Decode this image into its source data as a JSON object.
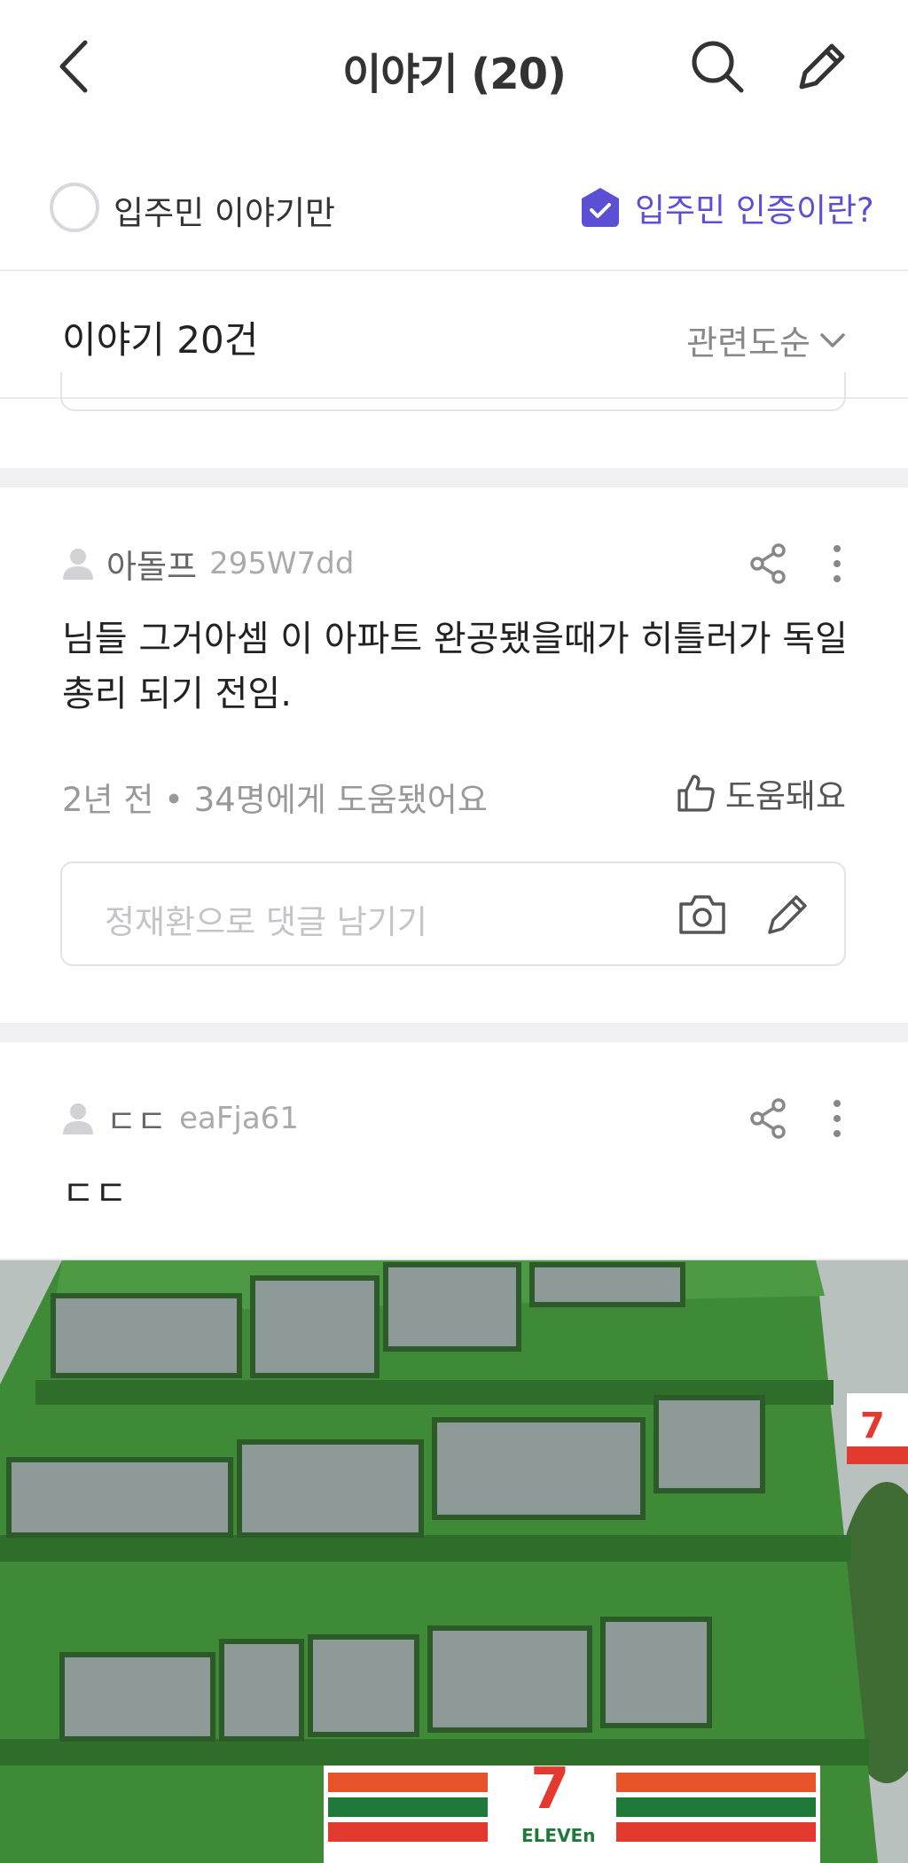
{
  "header": {
    "title": "이야기 (20)",
    "back_icon": "chevron-left-icon",
    "search_icon": "search-icon",
    "write_icon": "pencil-icon"
  },
  "filter": {
    "resident_only_label": "입주민 이야기만",
    "verify_label": "입주민 인증이란?",
    "accent": "#5b4fd4"
  },
  "list": {
    "count_label": "이야기 20건",
    "sort_label": "관련도순"
  },
  "posts": [
    {
      "author": "아돌프",
      "author_id": "295W7dd",
      "body": "님들 그거아셈 이 아파트 완공됐을때가 히틀러가 독일 총리 되기 전임.",
      "meta": "2년 전 • 34명에게 도움됐어요",
      "helpful_label": "도움돼요",
      "comment_placeholder": "정재환으로 댓글 남기기"
    },
    {
      "author": "ㄷㄷ",
      "author_id": "eaFja61",
      "body": "ㄷㄷ",
      "photo_sign_text": "ELEVEn"
    }
  ]
}
